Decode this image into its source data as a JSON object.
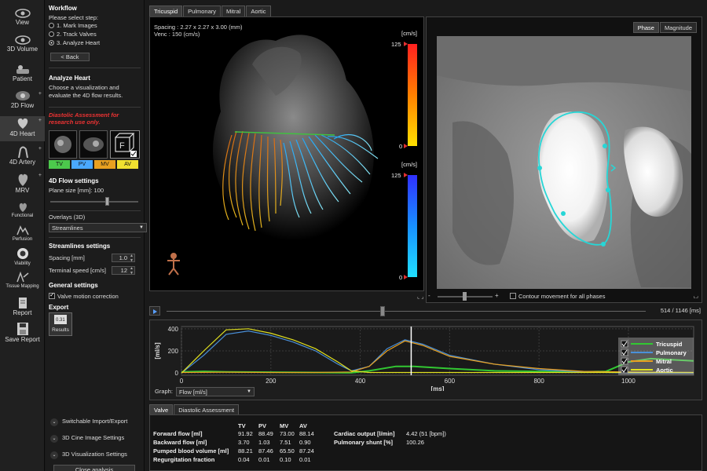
{
  "toolbar": [
    {
      "label": "View",
      "icon": "eye-icon"
    },
    {
      "label": "3D Volume",
      "icon": "3d-volume-icon",
      "sub": "3D"
    },
    {
      "label": "Patient",
      "icon": "patient-icon"
    },
    {
      "label": "2D Flow",
      "icon": "2d-flow-icon"
    },
    {
      "label": "4D Heart",
      "icon": "4d-heart-icon"
    },
    {
      "label": "4D Artery",
      "icon": "4d-artery-icon"
    },
    {
      "label": "MRV",
      "icon": "mrv-icon"
    },
    {
      "label": "Functional",
      "icon": "functional-icon"
    },
    {
      "label": "Perfusion",
      "icon": "perfusion-icon"
    },
    {
      "label": "Viability",
      "icon": "viability-icon"
    },
    {
      "label": "Tissue Mapping",
      "icon": "tissue-mapping-icon"
    },
    {
      "label": "Report",
      "icon": "report-icon"
    },
    {
      "label": "Save Report",
      "icon": "save-report-icon"
    }
  ],
  "panel": {
    "workflow_title": "Workflow",
    "workflow_prompt": "Please select step:",
    "steps": [
      "1. Mark Images",
      "2. Track Valves",
      "3. Analyze Heart"
    ],
    "back": "< Back",
    "analyze_title": "Analyze Heart",
    "analyze_text": "Choose a visualization and evaluate the 4D flow results.",
    "diastolic_warning": "Diastolic Assessment for research use only.",
    "valves": [
      "TV",
      "PV",
      "MV",
      "AV"
    ],
    "valve_colors": [
      "#4cc94c",
      "#4aa8ff",
      "#e8a020",
      "#f0e030"
    ],
    "flow_settings_title": "4D Flow settings",
    "plane_size_label": "Plane size [mm]: 100",
    "overlays_label": "Overlays (3D)",
    "overlays_value": "Streamlines",
    "streamlines_title": "Streamlines settings",
    "spacing_label": "Spacing [mm]",
    "spacing_value": "1.0",
    "terminal_label": "Terminal speed [cm/s]",
    "terminal_value": "12",
    "general_title": "General settings",
    "valve_motion": "Valve motion correction",
    "export_title": "Export",
    "results_label": "Results",
    "collapsibles": [
      "Switchable Import/Export",
      "3D Cine Image Settings",
      "3D Visualization Settings"
    ],
    "close_analysis": "Close analysis"
  },
  "tabs": [
    "Tricuspid",
    "Pulmonary",
    "Mitral",
    "Aortic"
  ],
  "view3d": {
    "spacing": "Spacing : 2.27 x 2.27 x 3.00 (mm)",
    "venc": "Venc : 150 (cm/s)",
    "unit": "[cm/s]",
    "scale_max": "125",
    "scale_min": "0"
  },
  "view2d": {
    "tabs": [
      "Phase",
      "Magnitude"
    ],
    "contour_label": "Contour movement for all phases",
    "zoom_minus": "-",
    "zoom_plus": "+"
  },
  "timeline": {
    "time": "514 / 1146 [ms]"
  },
  "graph": {
    "label": "Graph:",
    "select_value": "Flow [ml/s]",
    "chart_data": {
      "type": "line",
      "xlabel": "[ms]",
      "ylabel": "[ml/s]",
      "xlim": [
        0,
        1146
      ],
      "ylim": [
        -20,
        420
      ],
      "x_ticks": [
        0,
        200,
        400,
        600,
        800,
        1000
      ],
      "y_ticks": [
        0,
        200,
        400
      ],
      "cursor_x": 514,
      "legend": "top-right",
      "series": [
        {
          "name": "Tricuspid",
          "color": "#32c832",
          "x": [
            0,
            50,
            100,
            200,
            300,
            380,
            420,
            480,
            520,
            600,
            700,
            800,
            900,
            950,
            1000,
            1050,
            1146
          ],
          "y": [
            10,
            15,
            10,
            8,
            5,
            2,
            20,
            60,
            60,
            40,
            20,
            15,
            10,
            15,
            100,
            130,
            110
          ]
        },
        {
          "name": "Pulmonary",
          "color": "#4a90d9",
          "x": [
            0,
            50,
            100,
            150,
            200,
            250,
            300,
            350,
            380,
            420,
            460,
            500,
            540,
            600,
            700,
            800,
            900,
            1000,
            1146
          ],
          "y": [
            0,
            160,
            350,
            380,
            340,
            280,
            200,
            80,
            20,
            60,
            220,
            300,
            260,
            160,
            80,
            30,
            10,
            0,
            0
          ]
        },
        {
          "name": "Mitral",
          "color": "#e8a020",
          "x": [
            0,
            100,
            200,
            300,
            380,
            420,
            460,
            500,
            540,
            600,
            700,
            800,
            900,
            1000,
            1146
          ],
          "y": [
            5,
            8,
            5,
            5,
            10,
            60,
            200,
            290,
            250,
            150,
            80,
            40,
            15,
            10,
            5
          ]
        },
        {
          "name": "Aortic",
          "color": "#e0e020",
          "x": [
            0,
            50,
            100,
            150,
            200,
            250,
            300,
            350,
            380,
            420,
            500,
            600,
            700,
            800,
            900,
            1000,
            1146
          ],
          "y": [
            0,
            200,
            390,
            400,
            360,
            300,
            220,
            100,
            20,
            5,
            5,
            5,
            5,
            5,
            5,
            5,
            5
          ]
        }
      ]
    }
  },
  "bottom_tabs": [
    "Valve",
    "Diastolic Assessment"
  ],
  "results": {
    "columns": [
      "TV",
      "PV",
      "MV",
      "AV"
    ],
    "rows": [
      {
        "label": "Forward flow [ml]",
        "values": [
          "91.92",
          "88.49",
          "73.00",
          "88.14"
        ]
      },
      {
        "label": "Backward flow [ml]",
        "values": [
          "3.70",
          "1.03",
          "7.51",
          "0.90"
        ]
      },
      {
        "label": "Pumped blood volume [ml]",
        "values": [
          "88.21",
          "87.46",
          "65.50",
          "87.24"
        ]
      },
      {
        "label": "Regurgitation fraction",
        "values": [
          "0.04",
          "0.01",
          "0.10",
          "0.01"
        ]
      }
    ],
    "cardiac_output_label": "Cardiac output [l/min]",
    "cardiac_output_value": "4.42 (51 [bpm])",
    "shunt_label": "Pulmonary shunt [%]",
    "shunt_value": "100.26"
  }
}
